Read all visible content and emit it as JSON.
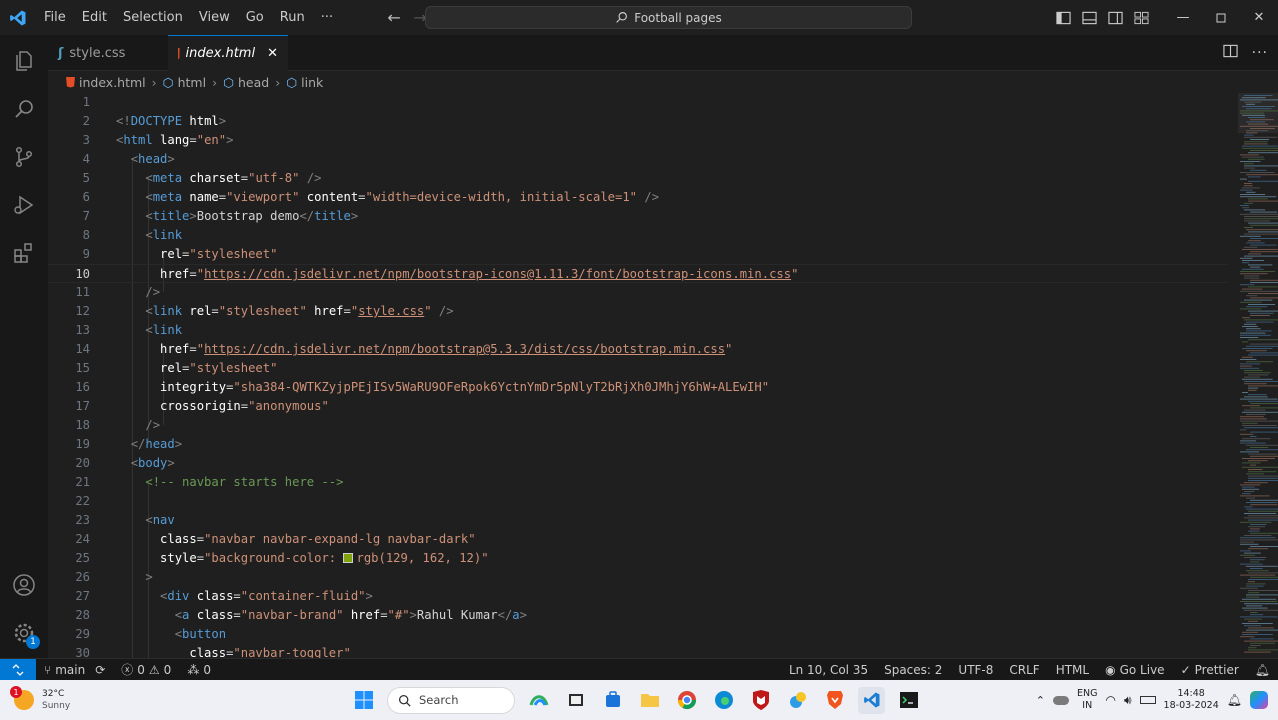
{
  "menu": [
    "File",
    "Edit",
    "Selection",
    "View",
    "Go",
    "Run",
    "···"
  ],
  "command_center": {
    "label": "Football pages"
  },
  "tabs": [
    {
      "label": "style.css",
      "icon": "css-file-icon"
    },
    {
      "label": "index.html",
      "icon": "html-file-icon",
      "active": true
    }
  ],
  "breadcrumb": [
    "index.html",
    "html",
    "head",
    "link"
  ],
  "editor": {
    "line_numbers": [
      "1",
      "2",
      "3",
      "4",
      "5",
      "6",
      "7",
      "8",
      "9",
      "10",
      "11",
      "12",
      "13",
      "14",
      "15",
      "16",
      "17",
      "18",
      "19",
      "20",
      "21",
      "22",
      "23",
      "24",
      "25",
      "26",
      "27",
      "28",
      "29",
      "30"
    ],
    "current_line": "10",
    "lines": {
      "l2": {
        "a": "<!",
        "b": "DOCTYPE",
        "c": " html",
        "d": ">"
      },
      "l3": {
        "a": "<",
        "b": "html",
        "c": " lang",
        "d": "=",
        "e": "\"en\"",
        "f": ">"
      },
      "l4": {
        "a": "<",
        "b": "head",
        "c": ">"
      },
      "l5": {
        "a": "<",
        "b": "meta",
        "c": " charset",
        "d": "=",
        "e": "\"utf-8\"",
        "f": " />"
      },
      "l6": {
        "a": "<",
        "b": "meta",
        "c": " name",
        "d": "=",
        "e": "\"viewport\"",
        "f": " content",
        "g": "=",
        "h": "\"width=device-width, initial-scale=1\"",
        "i": " />"
      },
      "l7": {
        "a": "<",
        "b": "title",
        "c": ">",
        "d": "Bootstrap demo",
        "e": "</",
        "f": "title",
        "g": ">"
      },
      "l8": {
        "a": "<",
        "b": "link"
      },
      "l9": {
        "a": "rel",
        "b": "=",
        "c": "\"stylesheet\""
      },
      "l10": {
        "a": "href",
        "b": "=",
        "c": "\"",
        "d": "https://cdn.jsdelivr.net/npm/bootstrap-icons@1.11.3/font/bootstrap-icons.min.css",
        "e": "\""
      },
      "l11": {
        "a": "/>"
      },
      "l12": {
        "a": "<",
        "b": "link",
        "c": " rel",
        "d": "=",
        "e": "\"stylesheet\"",
        "f": " href",
        "g": "=",
        "h": "\"",
        "i": "style.css",
        "j": "\"",
        "k": " />"
      },
      "l13": {
        "a": "<",
        "b": "link"
      },
      "l14": {
        "a": "href",
        "b": "=",
        "c": "\"",
        "d": "https://cdn.jsdelivr.net/npm/bootstrap@5.3.3/dist/css/bootstrap.min.css",
        "e": "\""
      },
      "l15": {
        "a": "rel",
        "b": "=",
        "c": "\"stylesheet\""
      },
      "l16": {
        "a": "integrity",
        "b": "=",
        "c": "\"sha384-QWTKZyjpPEjISv5WaRU9OFeRpok6YctnYmDr5pNlyT2bRjXh0JMhjY6hW+ALEwIH\""
      },
      "l17": {
        "a": "crossorigin",
        "b": "=",
        "c": "\"anonymous\""
      },
      "l18": {
        "a": "/>"
      },
      "l19": {
        "a": "</",
        "b": "head",
        "c": ">"
      },
      "l20": {
        "a": "<",
        "b": "body",
        "c": ">"
      },
      "l21": {
        "a": "<!-- navbar starts here -->"
      },
      "l23": {
        "a": "<",
        "b": "nav"
      },
      "l24": {
        "a": "class",
        "b": "=",
        "c": "\"navbar navbar-expand-lg navbar-dark\""
      },
      "l25": {
        "a": "style",
        "b": "=",
        "c": "\"background-color: ",
        "d": "rgb(129, 162, 12)\""
      },
      "l26": {
        "a": ">"
      },
      "l27": {
        "a": "<",
        "b": "div",
        "c": " class",
        "d": "=",
        "e": "\"container-fluid\"",
        "f": ">"
      },
      "l28": {
        "a": "<",
        "b": "a",
        "c": " class",
        "d": "=",
        "e": "\"navbar-brand\"",
        "f": " href",
        "g": "=",
        "h": "\"#\"",
        "i": ">",
        "j": "Rahul Kumar",
        "k": "</",
        "l": "a",
        "m": ">"
      },
      "l29": {
        "a": "<",
        "b": "button"
      },
      "l30": {
        "a": "class",
        "b": "=",
        "c": "\"navbar-toggler\""
      }
    }
  },
  "status": {
    "branch": "main",
    "errors": "0",
    "warnings": "0",
    "ports": "0",
    "cursor": "Ln 10, Col 35",
    "spaces": "Spaces: 2",
    "encoding": "UTF-8",
    "eol": "CRLF",
    "language": "HTML",
    "golive": "Go Live",
    "prettier": "Prettier"
  },
  "taskbar": {
    "temperature": "32°C",
    "weather": "Sunny",
    "weather_badge": "1",
    "search_placeholder": "Search",
    "lang_top": "ENG",
    "lang_bottom": "IN",
    "time": "14:48",
    "date": "18-03-2024"
  },
  "colors": {
    "accent": "#0078d4",
    "swatch": "#81a20c",
    "string": "#ce9178",
    "tag": "#569cd6",
    "comment": "#6a9955"
  },
  "settings_badge": "1"
}
